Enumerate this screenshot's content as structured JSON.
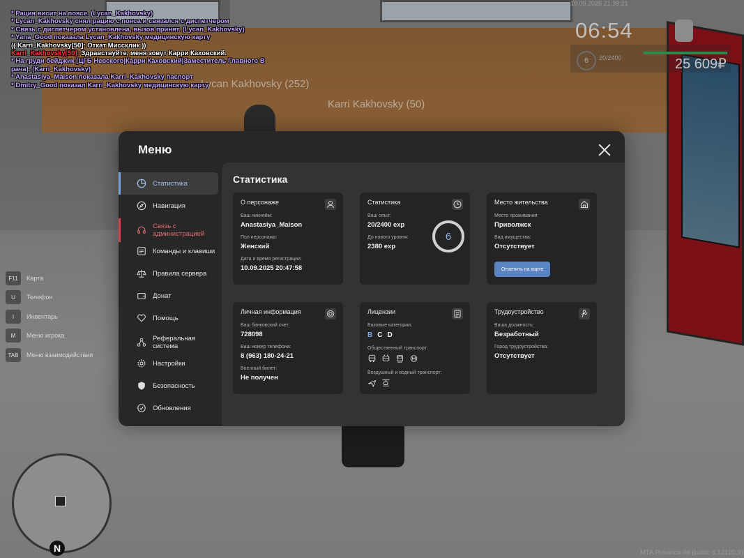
{
  "chat": [
    {
      "text": "* Рация висит на поясе. (Lycan_Kakhovsky)",
      "color": "purple"
    },
    {
      "text": "* Lycan_Kakhovsky снял рацию с пояса и связался с диспетчером",
      "color": "purple"
    },
    {
      "text": "* Связь с диспетчером установлена, вызов принят. (Lycan_Kakhovsky)",
      "color": "purple"
    },
    {
      "text": "* Yana_Good показала Lycan_Kakhovsky медицинскую карту",
      "color": "purple"
    },
    {
      "text": "(( Karri_Kakhovsky[50]: Откат Миссклик ))",
      "color": "white"
    },
    {
      "text": "Karri_Kakhovsky[50]: Здравствуйте, меня зовут Карри Каховский.",
      "color": "mixed",
      "name": "Karri_Kakhovsky[50]:",
      "rest": " Здравствуйте, меня зовут Карри Каховский."
    },
    {
      "text": "* На груди бейджик [ЦГБ Невского|Карри Каховский|Заместитель Главного В",
      "color": "purple"
    },
    {
      "text": "рача]. (Karri_Kakhovsky)",
      "color": "purple"
    },
    {
      "text": "* Anastasiya_Maison показала Karri_Kakhovsky паспорт",
      "color": "purple"
    },
    {
      "text": "* Dmitry_Good показал Karri_Kakhovsky медицинскую карту",
      "color": "purple"
    }
  ],
  "nametags": {
    "lycan": "Lycan Kakhovsky (252)",
    "karri": "Karri Kakhovsky (50)"
  },
  "hud": {
    "date": "10.09.2025 21:39:21",
    "time": "06:54",
    "level": "6",
    "exp": "20/2400",
    "money": "25 609₽"
  },
  "keybinds": [
    {
      "key": "F11",
      "label": "Карта"
    },
    {
      "key": "U",
      "label": "Телефон"
    },
    {
      "key": "I",
      "label": "Инвентарь"
    },
    {
      "key": "M",
      "label": "Меню игрока"
    },
    {
      "key": "TAB",
      "label": "Меню взаимодействия"
    }
  ],
  "minimap": {
    "north": "N"
  },
  "build": "MTA Province #6 (build: 6.12120.9)",
  "menu": {
    "title": "Меню",
    "sidebar": [
      {
        "label": "Статистика",
        "icon": "pie-chart-icon",
        "state": "active"
      },
      {
        "label": "Навигация",
        "icon": "compass-icon",
        "state": ""
      },
      {
        "label": "Связь с администрацией",
        "icon": "headset-icon",
        "state": "alert"
      },
      {
        "label": "Команды и клавиши",
        "icon": "keyboard-icon",
        "state": ""
      },
      {
        "label": "Правила сервера",
        "icon": "scales-icon",
        "state": ""
      },
      {
        "label": "Донат",
        "icon": "wallet-icon",
        "state": ""
      },
      {
        "label": "Помощь",
        "icon": "heart-icon",
        "state": ""
      },
      {
        "label": "Реферальная система",
        "icon": "network-icon",
        "state": ""
      },
      {
        "label": "Настройки",
        "icon": "gear-icon",
        "state": ""
      },
      {
        "label": "Безопасность",
        "icon": "shield-icon",
        "state": ""
      },
      {
        "label": "Обновления",
        "icon": "refresh-icon",
        "state": ""
      }
    ],
    "content": {
      "title": "Статистика",
      "about": {
        "title": "О персонаже",
        "nick_label": "Ваш никнейм:",
        "nick": "Anastasiya_Maison",
        "gender_label": "Пол персонажа:",
        "gender": "Женский",
        "reg_label": "Дата и время регистрации:",
        "reg": "10.09.2025 20:47:58"
      },
      "stats": {
        "title": "Статистика",
        "exp_label": "Ваш опыт:",
        "exp": "20/2400 exp",
        "next_label": "До нового уровня:",
        "next": "2380 exp",
        "level": "6"
      },
      "residence": {
        "title": "Место жительства",
        "place_label": "Место проживания:",
        "place": "Приволжск",
        "property_label": "Вид имущества:",
        "property": "Отсутствует",
        "map_button": "Отметить на карте"
      },
      "personal": {
        "title": "Личная информация",
        "bank_label": "Ваш банковский счет:",
        "bank": "728098",
        "phone_label": "Ваш номер телефона:",
        "phone": "8 (963) 180-24-21",
        "military_label": "Военный билет:",
        "military": "Не получен"
      },
      "licenses": {
        "title": "Лицензии",
        "base_label": "Базовые категории:",
        "base": [
          "B",
          "C",
          "D"
        ],
        "public_label": "Общественный транспорт:",
        "air_label": "Воздушный и водный транспорт:"
      },
      "job": {
        "title": "Трудоустройство",
        "position_label": "Ваша должность:",
        "position": "Безработный",
        "city_label": "Город трудоустройства:",
        "city": "Отсутствует"
      }
    }
  }
}
